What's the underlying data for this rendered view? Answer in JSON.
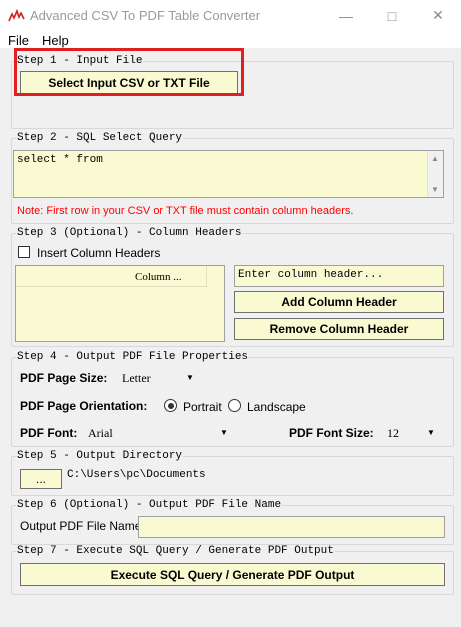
{
  "window": {
    "title": "Advanced CSV To PDF Table Converter"
  },
  "menu": {
    "file": "File",
    "help": "Help"
  },
  "step1": {
    "label": "Step 1 - Input File",
    "button": "Select Input CSV or TXT File"
  },
  "step2": {
    "label": "Step 2 - SQL Select Query",
    "query": "select * from",
    "note": "Note: First row in your CSV or TXT file must contain column headers."
  },
  "step3": {
    "label": "Step 3 (Optional) - Column Headers",
    "checkbox_label": "Insert Column Headers",
    "checkbox_checked": false,
    "list_header": "Column ...",
    "header_placeholder": "Enter column header...",
    "add_button": "Add Column Header",
    "remove_button": "Remove Column Header"
  },
  "step4": {
    "label": "Step 4 - Output PDF File Properties",
    "page_size_label": "PDF Page Size:",
    "page_size_value": "Letter",
    "orientation_label": "PDF Page Orientation:",
    "portrait": "Portrait",
    "landscape": "Landscape",
    "orientation_selected": "Portrait",
    "font_label": "PDF Font:",
    "font_value": "Arial",
    "font_size_label": "PDF Font Size:",
    "font_size_value": "12"
  },
  "step5": {
    "label": "Step 5 - Output Directory",
    "browse": "...",
    "path": "C:\\Users\\pc\\Documents"
  },
  "step6": {
    "label": "Step 6 (Optional) - Output PDF File Name",
    "name_label": "Output PDF File Name:",
    "name_value": ""
  },
  "step7": {
    "label": "Step 7 - Execute SQL Query / Generate PDF Output",
    "button": "Execute SQL Query / Generate PDF Output"
  },
  "colors": {
    "field_bg": "#fafad2",
    "highlight": "#e02020",
    "note": "#ff0000"
  },
  "icons": {
    "app": "chart-icon",
    "minimize": "minimize-icon",
    "maximize": "maximize-icon",
    "close": "close-icon"
  }
}
